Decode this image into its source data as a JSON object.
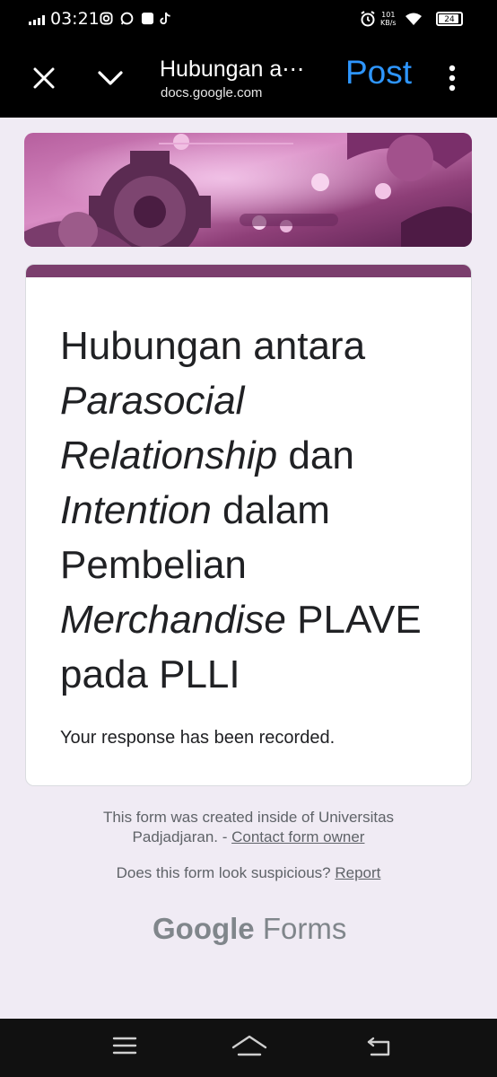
{
  "status_bar": {
    "time": "03:21",
    "net_speed_value": "101",
    "net_speed_unit": "KB/s",
    "battery": "24"
  },
  "app_bar": {
    "title": "Hubungan a⋯",
    "url": "docs.google.com",
    "post_label": "Post",
    "icons": [
      "close-icon",
      "chevron-down-icon",
      "more-vert-icon"
    ]
  },
  "form": {
    "title_parts": [
      {
        "text": "Hubungan antara ",
        "italic": false
      },
      {
        "text": "Parasocial Relationship",
        "italic": true
      },
      {
        "text": " dan ",
        "italic": false
      },
      {
        "text": "Intention",
        "italic": true
      },
      {
        "text": " dalam Pembelian ",
        "italic": false
      },
      {
        "text": "Merchandise",
        "italic": true
      },
      {
        "text": " PLAVE pada PLLI",
        "italic": false
      }
    ],
    "confirmation": "Your response has been recorded.",
    "accent_color": "#7b3e6d"
  },
  "footer": {
    "created_line1": "This form was created inside of Universitas",
    "created_line2_prefix": "Padjadjaran. - ",
    "contact_link": "Contact form owner",
    "suspicious_text": "Does this form look suspicious? ",
    "report_link": "Report",
    "logo_google": "Google",
    "logo_forms": "Forms"
  },
  "nav_bar": {
    "icons": [
      "menu-icon",
      "home-icon",
      "back-icon"
    ]
  }
}
